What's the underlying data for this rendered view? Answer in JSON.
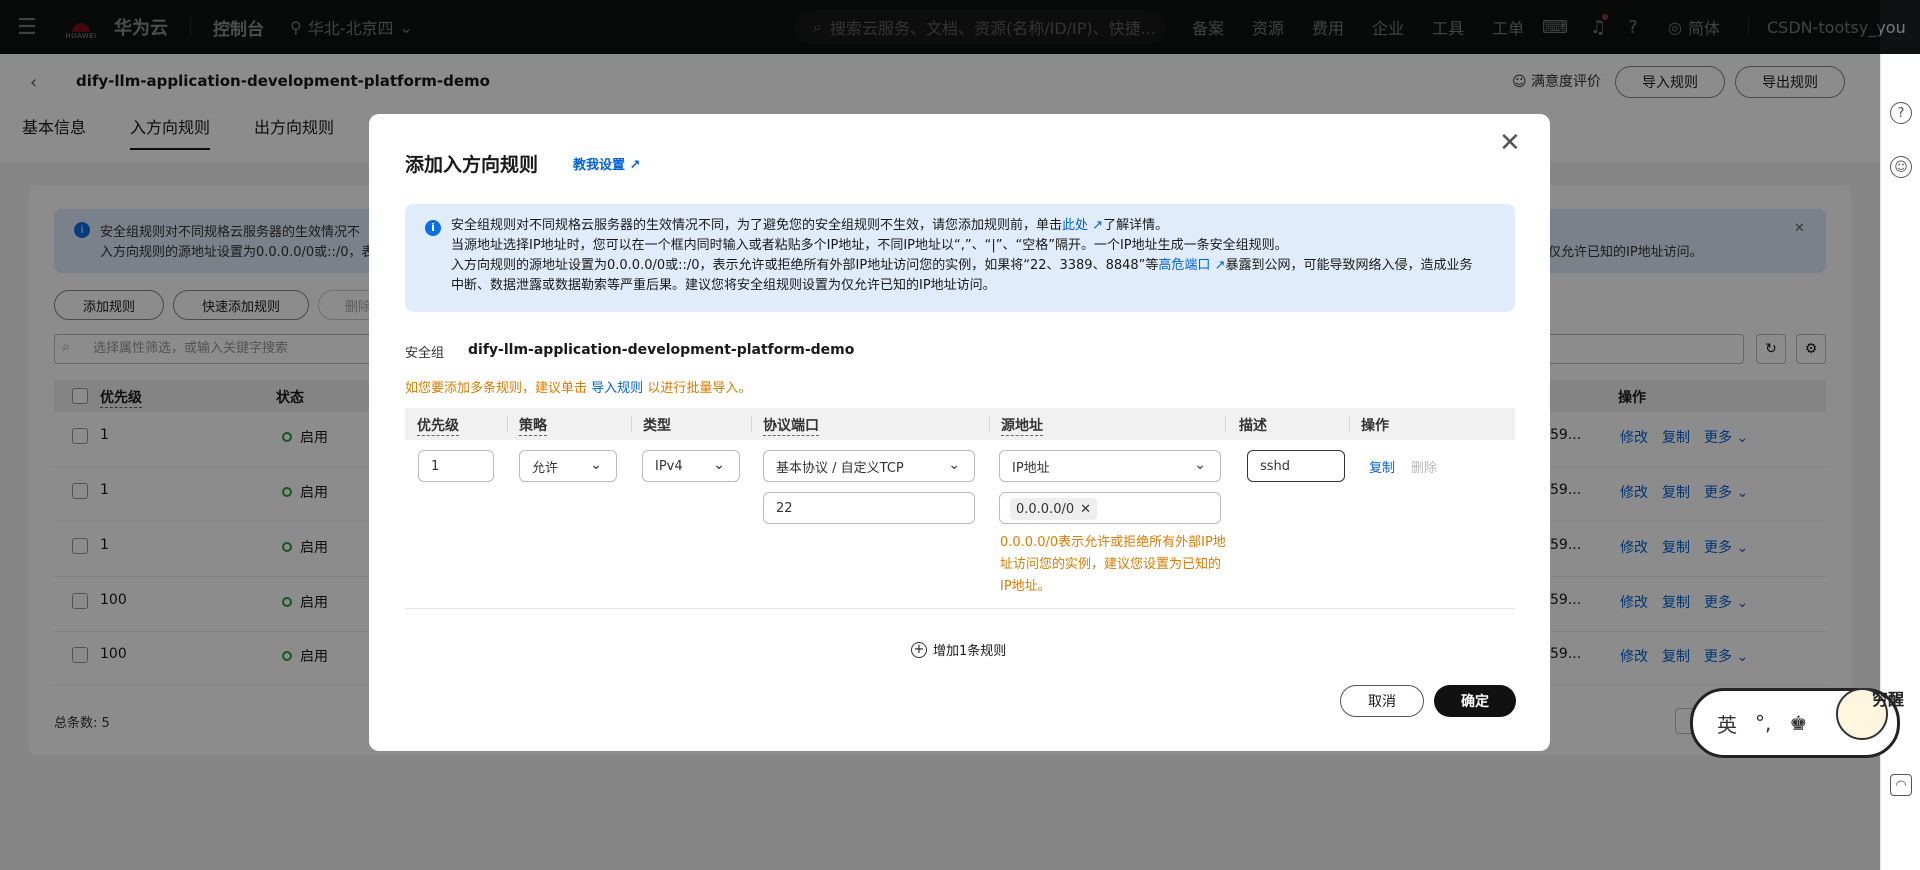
{
  "topnav": {
    "brand": "华为云",
    "logo_text": "HUAWEI",
    "console": "控制台",
    "region": "华北-北京四",
    "search_placeholder": "搜索云服务、文档、资源(名称/ID/IP)、快捷...",
    "links": [
      "备案",
      "资源",
      "费用",
      "企业",
      "工具",
      "工单"
    ],
    "lang": "简体",
    "user": "CSDN-tootsy_you"
  },
  "header": {
    "title": "dify-llm-application-development-platform-demo",
    "satisfaction": "满意度评价",
    "import_btn": "导入规则",
    "export_btn": "导出规则",
    "tabs": [
      "基本信息",
      "入方向规则",
      "出方向规则"
    ]
  },
  "bg": {
    "alert_line1": "安全组规则对不同规格云服务器的生效情况不",
    "alert_line2": "入方向规则的源地址设置为0.0.0.0/0或::/0，表",
    "alert_tail": "仅允许已知的IP地址访问。",
    "add_rule": "添加规则",
    "quick_add": "快速添加规则",
    "delete": "删除",
    "search_placeholder": "选择属性筛选，或输入关键字搜索",
    "col_priority": "优先级",
    "col_status": "状态",
    "col_action": "操作",
    "rows": [
      {
        "priority": "1",
        "status": "启用",
        "trunc": "59..."
      },
      {
        "priority": "1",
        "status": "启用",
        "trunc": "59..."
      },
      {
        "priority": "1",
        "status": "启用",
        "trunc": "59..."
      },
      {
        "priority": "100",
        "status": "启用",
        "trunc": "59..."
      },
      {
        "priority": "100",
        "status": "启用",
        "trunc": "59..."
      }
    ],
    "act_edit": "修改",
    "act_copy": "复制",
    "act_more": "更多",
    "total": "总条数: 5"
  },
  "modal": {
    "title": "添加入方向规则",
    "teach": "教我设置",
    "alert": {
      "l1a": "安全组规则对不同规格云服务器的生效情况不同，为了避免您的安全组规则不生效，请您添加规则前，单击",
      "l1link": "此处",
      "l1b": "了解详情。",
      "l2": "当源地址选择IP地址时，您可以在一个框内同时输入或者粘贴多个IP地址，不同IP地址以“,”、“|”、“空格”隔开。一个IP地址生成一条安全组规则。",
      "l3a": "入方向规则的源地址设置为0.0.0.0/0或::/0，表示允许或拒绝所有外部IP地址访问您的实例，如果将“22、3389、8848”等",
      "l3link": "高危端口",
      "l3b": "暴露到公网，可能导致网络入侵，造成业务",
      "l4": "中断、数据泄露或数据勒索等严重后果。建议您将安全组规则设置为仅允许已知的IP地址访问。"
    },
    "sg_label": "安全组",
    "sg_name": "dify-llm-application-development-platform-demo",
    "multi_a": "如您要添加多条规则，建议单击",
    "multi_link": "导入规则",
    "multi_b": "以进行批量导入。",
    "cols": {
      "priority": "优先级",
      "policy": "策略",
      "type": "类型",
      "port": "协议端口",
      "source": "源地址",
      "desc": "描述",
      "action": "操作"
    },
    "row": {
      "priority": "1",
      "policy": "允许",
      "type": "IPv4",
      "protocol": "基本协议 / 自定义TCP",
      "port": "22",
      "source_type": "IP地址",
      "source_tag": "0.0.0.0/0",
      "desc": "sshd",
      "copy": "复制",
      "delete": "删除"
    },
    "warning": "0.0.0.0/0表示允许或拒绝所有外部IP地址访问您的实例，建议您设置为已知的IP地址。",
    "add_rule": "增加1条规则",
    "cancel": "取消",
    "confirm": "确定"
  },
  "sticker": {
    "text1": "英",
    "text2": "°,",
    "corner": "穷醒"
  },
  "colors": {
    "link": "#0062d9",
    "warning": "#e07a00",
    "nav_bg": "#1e1f22",
    "alert_bg": "#e1ecfb",
    "status_green": "#2a9d3a"
  }
}
